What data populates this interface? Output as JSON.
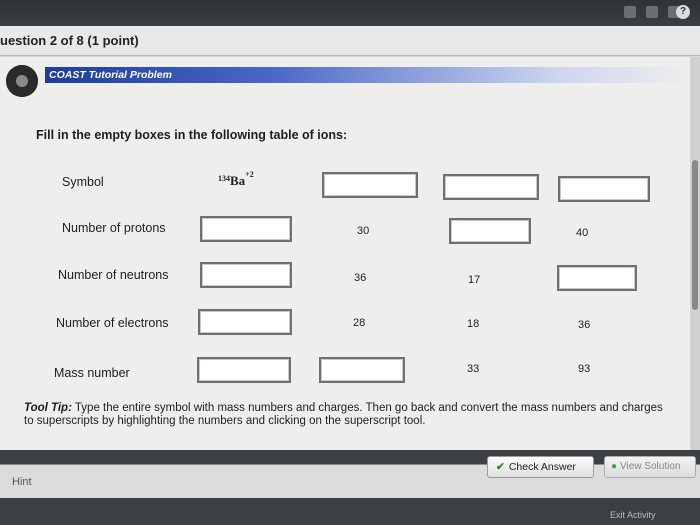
{
  "header": {
    "question_title": "uestion 2 of 8 (1 point)"
  },
  "banner": {
    "title": "COAST Tutorial Problem"
  },
  "instructions": "Fill in the empty boxes in the following table of ions:",
  "table": {
    "row_labels": {
      "symbol": "Symbol",
      "protons": "Number of protons",
      "neutrons": "Number of neutrons",
      "electrons": "Number of electrons",
      "mass": "Mass number"
    },
    "given_symbol": {
      "mass_number": "134",
      "element": "Ba",
      "charge": "+2"
    },
    "values": {
      "protons_col2": "30",
      "protons_col4": "40",
      "neutrons_col2": "36",
      "neutrons_col3": "17",
      "electrons_col2": "28",
      "electrons_col3": "18",
      "electrons_col4": "36",
      "mass_col3": "33",
      "mass_col4": "93"
    }
  },
  "tooltip": {
    "label": "Tool Tip:",
    "text": "Type the entire symbol with mass numbers and charges. Then go back and convert the mass numbers and charges to superscripts by highlighting the numbers and clicking on the superscript tool."
  },
  "footer": {
    "hint": "Hint",
    "check_answer": "Check Answer",
    "view_solution": "View Solution",
    "exit": "Exit Activity"
  },
  "colors": {
    "banner": "#1e3c9c",
    "check_icon": "#2f8a1f"
  }
}
